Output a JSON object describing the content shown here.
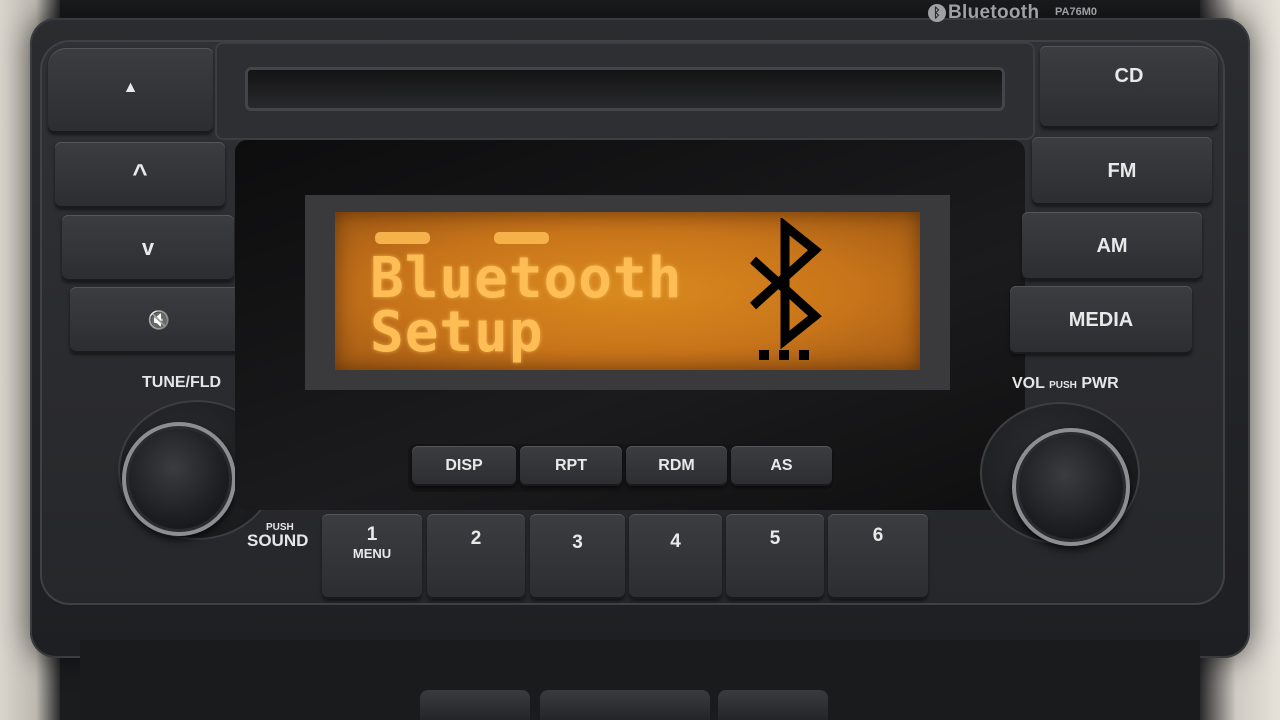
{
  "header": {
    "brand": "Bluetooth",
    "model": "PA76M0"
  },
  "display": {
    "line1": "Bluetooth",
    "line2": "Setup"
  },
  "left_buttons": {
    "eject": "▲",
    "up": "^",
    "down": "v",
    "mute": "🔇"
  },
  "right_buttons": {
    "cd": "CD",
    "fm": "FM",
    "am": "AM",
    "media": "MEDIA"
  },
  "function_buttons": [
    "DISP",
    "RPT",
    "RDM",
    "AS"
  ],
  "number_buttons": [
    {
      "num": "1",
      "sub": "MENU"
    },
    {
      "num": "2",
      "sub": ""
    },
    {
      "num": "3",
      "sub": ""
    },
    {
      "num": "4",
      "sub": ""
    },
    {
      "num": "5",
      "sub": ""
    },
    {
      "num": "6",
      "sub": ""
    }
  ],
  "knobs": {
    "tune_label": "TUNE/FLD",
    "sound_push": "PUSH",
    "sound_label": "SOUND",
    "vol_label": "VOL",
    "vol_push": "PUSH",
    "vol_pwr": "PWR"
  },
  "colors": {
    "lcd": "#c8741a",
    "lcd_text": "#ffbe55",
    "panel": "#26272a"
  }
}
